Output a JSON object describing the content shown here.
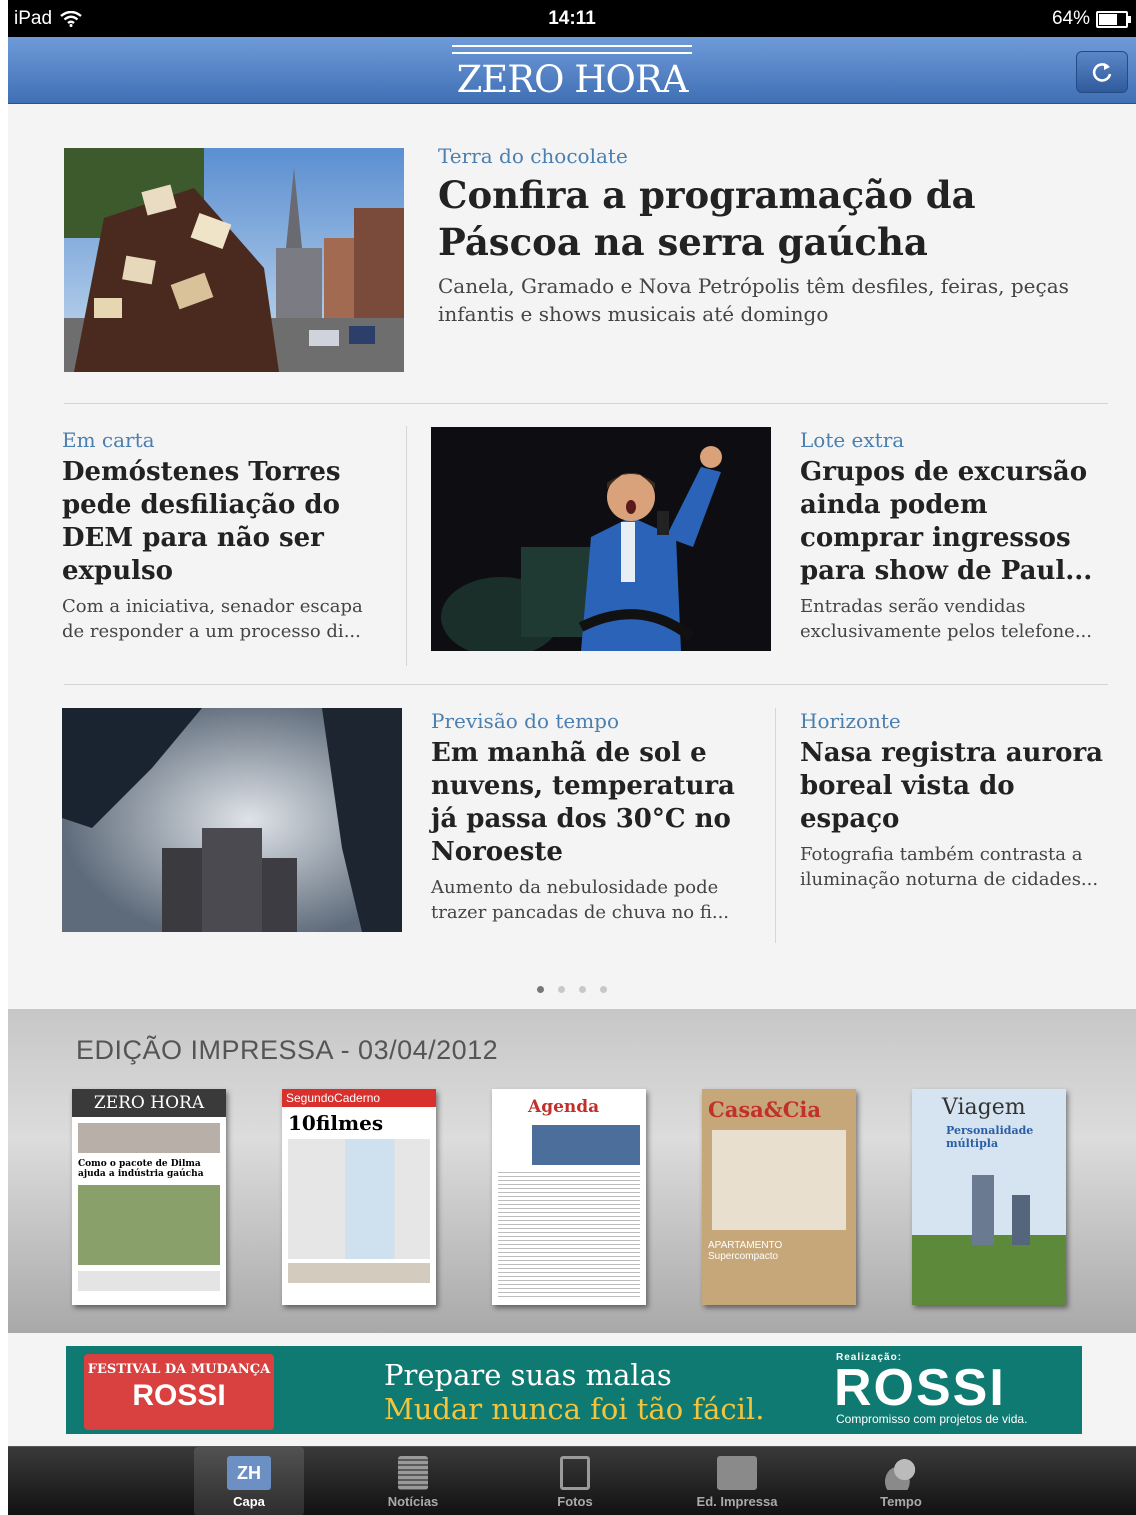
{
  "status_bar": {
    "device": "iPad",
    "time": "14:11",
    "battery": "64%",
    "battery_level": 0.64
  },
  "header": {
    "logo": "ZERO HORA",
    "refresh_icon": "refresh-icon"
  },
  "stories": [
    {
      "kicker": "Terra do chocolate",
      "headline": "Confira a programação da Páscoa na serra gaúcha",
      "summary": "Canela, Gramado e Nova Petrópolis têm desfiles, feiras, peças infantis e shows musicais até domingo"
    },
    {
      "kicker": "Em carta",
      "headline": "Demóstenes Torres pede desfiliação do DEM para não ser expulso",
      "summary": "Com a iniciativa, senador escapa de responder a um processo di..."
    },
    {
      "kicker": "Lote extra",
      "headline": "Grupos de excursão ainda podem comprar ingressos para show de Paul...",
      "summary": "Entradas serão vendidas exclusivamente pelos telefone..."
    },
    {
      "kicker": "Previsão do tempo",
      "headline": "Em manhã de sol e nuvens, temperatura já passa dos 30°C no Noroeste",
      "summary": "Aumento da nebulosidade pode trazer pancadas de chuva no fi..."
    },
    {
      "kicker": "Horizonte",
      "headline": "Nasa registra aurora boreal vista do espaço",
      "summary": "Fotografia também contrasta a iluminação noturna de cidades..."
    }
  ],
  "pagination": {
    "pages": 4,
    "current": 1
  },
  "print_edition": {
    "title": "EDIÇÃO IMPRESSA - 03/04/2012",
    "covers": [
      {
        "title": "ZERO HORA",
        "line": "Como o pacote de Dilma ajuda a indústria gaúcha"
      },
      {
        "title": "SegundoCaderno",
        "line": "10filmes"
      },
      {
        "title": "Agenda",
        "line": ""
      },
      {
        "title": "Casa&Cia",
        "line": "APARTAMENTO Supercompacto"
      },
      {
        "title": "Viagem",
        "line": "Personalidade múltipla"
      }
    ]
  },
  "ad": {
    "badge_top": "FESTIVAL DA MUDANÇA",
    "badge_brand": "ROSSI",
    "line1": "Prepare suas malas",
    "line2": "Mudar nunca foi tão fácil.",
    "realizacao": "Realização:",
    "brand": "ROSSI",
    "tagline": "Compromisso com projetos de vida."
  },
  "tabs": [
    {
      "label": "Capa",
      "icon": "zh-logo-icon",
      "active": true
    },
    {
      "label": "Notícias",
      "icon": "news-icon",
      "active": false
    },
    {
      "label": "Fotos",
      "icon": "photos-icon",
      "active": false
    },
    {
      "label": "Ed. Impressa",
      "icon": "newspaper-icon",
      "active": false
    },
    {
      "label": "Tempo",
      "icon": "weather-icon",
      "active": false
    }
  ]
}
